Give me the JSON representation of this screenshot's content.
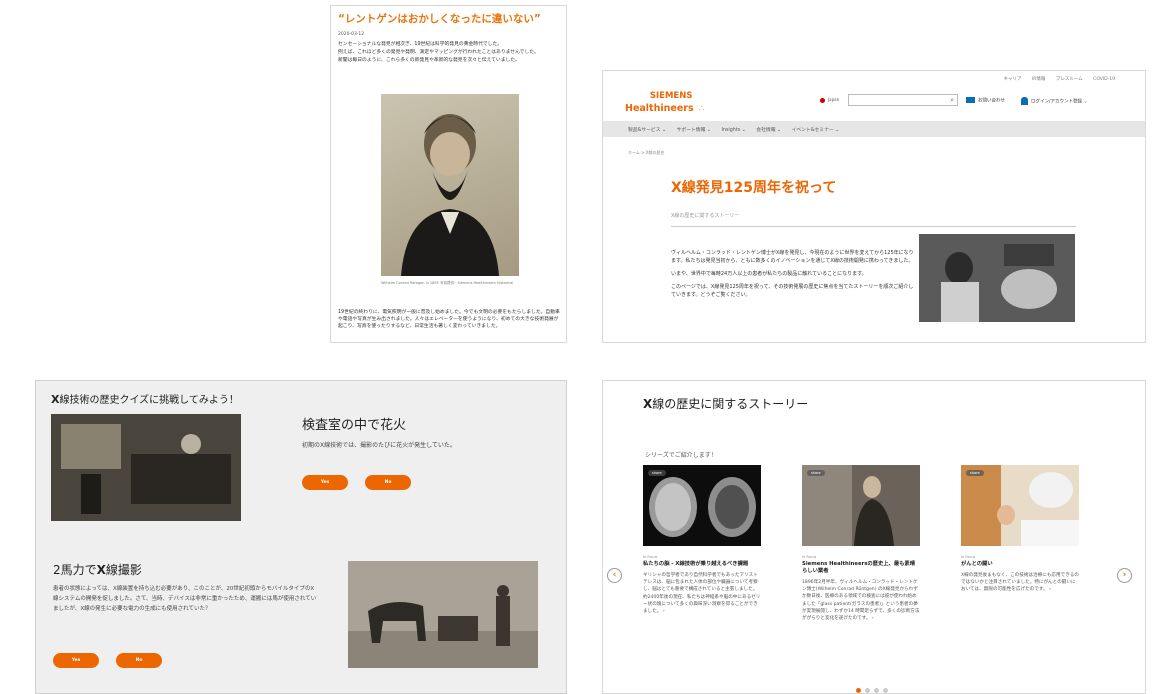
{
  "article": {
    "title": "“レントゲンはおかしくなったに違いない”",
    "date": "2020-03-12",
    "paragraphs": [
      "センセーショナルな発見が相次ぎ、19世紀は科学的発見の黄金時代でした。",
      "例えば、これほど多くの発見や発明、測定やマッピングが行われたことはありませんでした。",
      "新聞は毎日のように、これら多くの新発見や革新的な発見を次々と伝えていました。"
    ],
    "caption": "Wilhelm Conrad Röntgen in 1895\n写真提供：Siemens Healthineers Historical",
    "closing": "19世紀の終わりに、電気照明が一般に普及し始めました。今でも文明の必要をもたらしました。自動車や電話や写真が生み出されました。人々はエレベーターを使うようになり、初めての大きな技術発展が起こり、写真を使ったりするなど、日常生活も著しく変わっていきました。"
  },
  "siemens": {
    "toplinks": [
      "キャリア",
      "IR情報",
      "プレスルーム",
      "COVID-19"
    ],
    "logo_line1": "SIEMENS",
    "logo_line2": "Healthineers",
    "logo_dots": "∴",
    "lang": "Japan",
    "search_icon": "⌕",
    "contact": "お問い合わせ",
    "login": "ログイン/アカウント登録",
    "login_caret": "⌄",
    "nav": [
      "製品&サービス ⌄",
      "サポート情報 ⌄",
      "Insights ⌄",
      "会社情報 ⌄",
      "イベント&セミナー ⌄"
    ],
    "breadcrumb": "ホーム > X線の歴史",
    "heading": "X線発見125周年を祝って",
    "subheading": "X線の歴史に関するストーリー",
    "intro": [
      "ヴィルヘルム・コンラッド・レントゲン博士がX線を発見し、今現在のように世界を変えてから125年になります。私たちは発見当初から、ともに数多くのイノベーションを通じてX線の技術開発に携わってきました。",
      "いまや、世界中で毎時24万人以上の患者が私たちの製品に触れていることになります。",
      "このページでは、X線発見125周年を祝って、その技術発展の歴史に焦点を当てたストーリーを順次ご紹介していきます。どうぞご覧ください。"
    ]
  },
  "quiz": {
    "title_prefix": "X",
    "title_rest": "線技術の歴史クイズに挑戦してみよう！",
    "q1_title": "検査室の中で花火",
    "q1_text": "初期のX線技術では、撮影のたびに花火が発生していた。",
    "q2_title_prefix": "2馬力で",
    "q2_title_x": "X",
    "q2_title_rest": "線撮影",
    "q2_text": "患者の状態によっては、X線装置を持ち込む必要があり、このことが、20世紀初頭からモバイルタイプのX線システムの開発を促しました。さて、当時、デバイスは非常に重かったため、運搬には馬が使用されていましたが、X線の発生に必要な電力の生成にも使用されていた？",
    "yes": "Yes",
    "no": "No"
  },
  "stories": {
    "heading_prefix": "X",
    "heading_rest": "線の歴史に関するストーリー",
    "series_label": "シリーズでご紹介します！",
    "share": "share",
    "prev": "‹",
    "next": "›",
    "cards": [
      {
        "tag": "In Focus",
        "title": "私たちの脳 - X線技術が乗り越えるべき課題",
        "text": "ギリシャの哲学者であり自然科学者でもあったアリストテレスは、脳に包まれた人体の部位や臓器について考察し、脳はとても重要で構成されていると主張しました。約2400年後の現在、私たちは神経系や脳の中にあるゼリー状の塊について多くの興味深い洞察を得ることができました。",
        "arrow": "›"
      },
      {
        "tag": "In Focus",
        "title": "Siemens Healthineersの歴史上、最も素晴らしい業者",
        "text": "1896年2月半年、ヴィルヘルム・コンラッド・レントゲン博士(Wilhelm Conrad Röntgen) のX線発見からわずか数日後、医療のある領域での検査には彼が使われ始めました「glass patient(ガラスの患者)」という患者の夢が実現展開し、わずか14 時間足らずで、多くの診断方法ががらりと変化を遂げたのです。",
        "arrow": "›"
      },
      {
        "tag": "In Focus",
        "title": "がんとの闘い",
        "text": "X線の発見後まもなく、この技術は治療にも応用できるのではないかと注目されていました。特にがんとの闘いにおいては、無限の可能性を広げたのです。",
        "arrow": "›"
      }
    ]
  }
}
